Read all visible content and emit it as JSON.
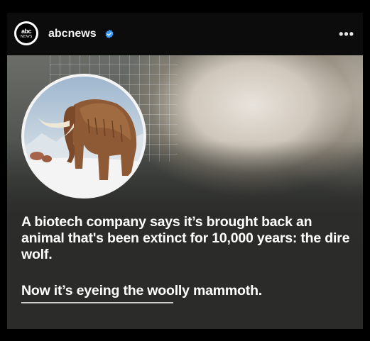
{
  "post": {
    "account": {
      "username": "abcnews",
      "avatar_text_top": "abc",
      "avatar_text_bottom": "NEWS",
      "verified_icon": "verified-badge-icon",
      "verified_color": "#3897f0"
    },
    "more_icon": "more-options-icon",
    "more_glyph": "•••",
    "media": {
      "headline": "A biotech company says it’s brought back an animal that's been extinct for 10,000 years: the dire wolf.",
      "subheadline": "Now it’s eyeing the woolly mammoth."
    }
  }
}
